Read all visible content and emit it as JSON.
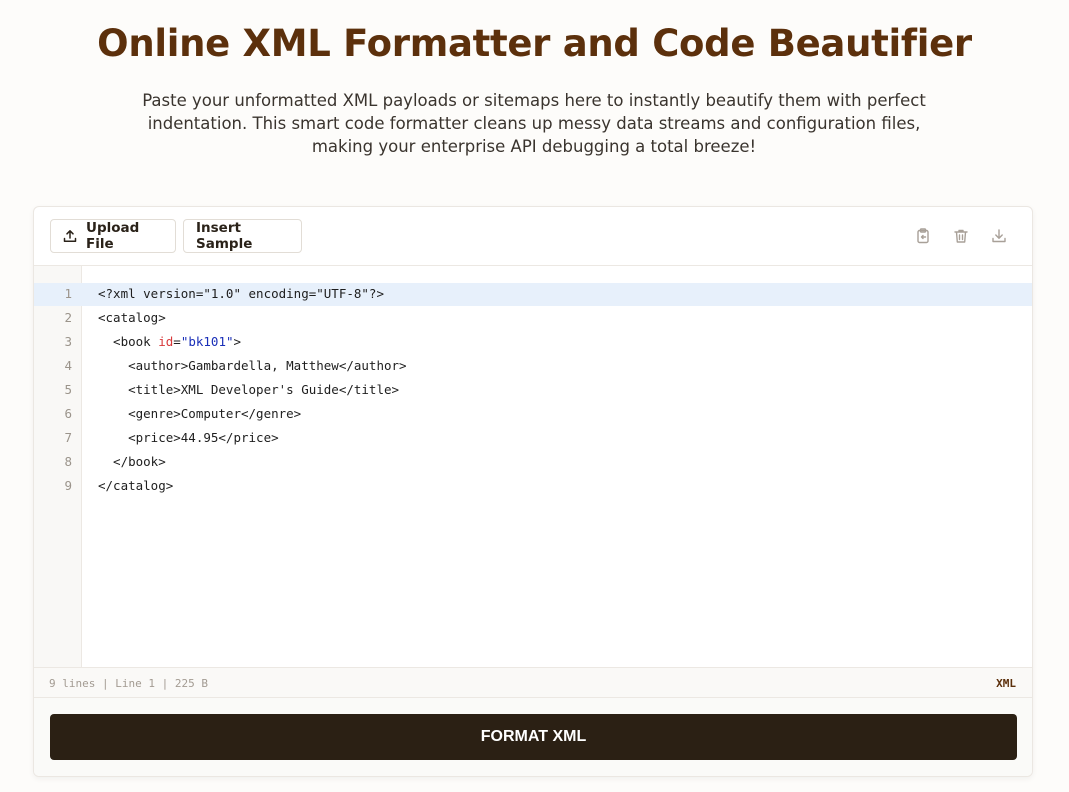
{
  "header": {
    "title": "Online XML Formatter and Code Beautifier",
    "subtitle": "Paste your unformatted XML payloads or sitemaps here to instantly beautify them with perfect indentation. This smart code formatter cleans up messy data streams and configuration files, making your enterprise API debugging a total breeze!"
  },
  "toolbar": {
    "upload_label": "Upload File",
    "upload_icon": "upload-icon",
    "sample_label": "Insert Sample",
    "icons": [
      "copy-icon",
      "trash-icon",
      "download-icon"
    ]
  },
  "editor": {
    "active_line": 1,
    "lines": [
      {
        "n": "1",
        "text": "<?xml version=\"1.0\" encoding=\"UTF-8\"?>"
      },
      {
        "n": "2",
        "text": "<catalog>"
      },
      {
        "n": "3",
        "pre": "  <book ",
        "attr": "id",
        "eq": "=",
        "val": "\"bk101\"",
        "post": ">"
      },
      {
        "n": "4",
        "text": "    <author>Gambardella, Matthew</author>"
      },
      {
        "n": "5",
        "text": "    <title>XML Developer's Guide</title>"
      },
      {
        "n": "6",
        "text": "    <genre>Computer</genre>"
      },
      {
        "n": "7",
        "text": "    <price>44.95</price>"
      },
      {
        "n": "8",
        "text": "  </book>"
      },
      {
        "n": "9",
        "text": "</catalog>"
      }
    ]
  },
  "status": {
    "left": "9 lines | Line 1 | 225 B",
    "language": "XML"
  },
  "actions": {
    "format_label": "FORMAT XML"
  },
  "colors": {
    "title": "#5c300c",
    "button": "#2b2014",
    "active_line": "#e7f0fb",
    "attr": "#d8383a",
    "value": "#1a2fb8"
  }
}
